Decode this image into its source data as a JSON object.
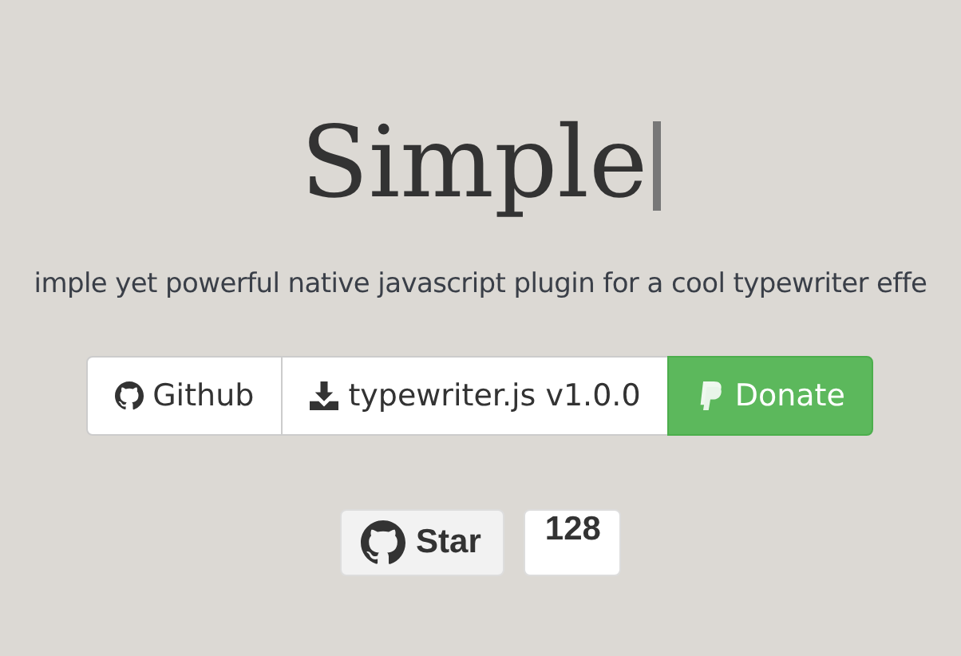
{
  "title": "Simple",
  "cursor": true,
  "subtitle": "imple yet powerful native javascript plugin for a cool typewriter effe",
  "buttons": [
    {
      "kind": "github",
      "label": "Github"
    },
    {
      "kind": "download",
      "label": "typewriter.js v1.0.0"
    },
    {
      "kind": "donate",
      "label": "Donate"
    }
  ],
  "star": {
    "label": "Star",
    "count": "128"
  }
}
